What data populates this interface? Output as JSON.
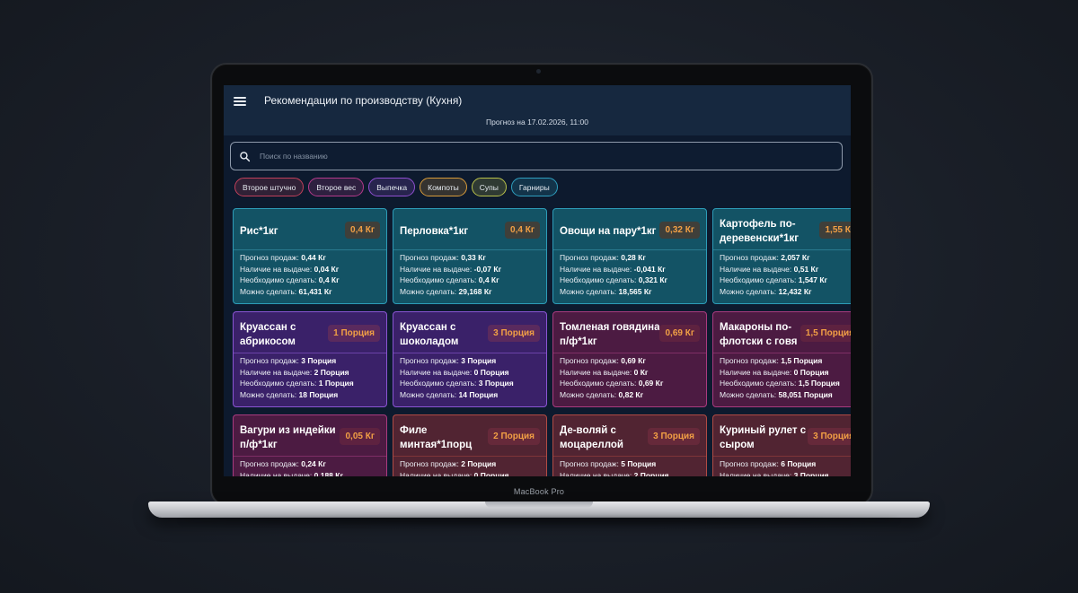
{
  "device": {
    "label": "MacBook Pro"
  },
  "app": {
    "title": "Рекомендации по производству (Кухня)",
    "forecast": "Прогноз на 17.02.2026, 11:00"
  },
  "search": {
    "placeholder": "Поиск по названию",
    "value": ""
  },
  "stat_labels": {
    "forecast": "Прогноз продаж:",
    "available": "Наличие на выдаче:",
    "needed": "Необходимо сделать:",
    "possible": "Можно сделать:"
  },
  "chips": [
    {
      "label": "Второе штучно",
      "color": "#c0405a"
    },
    {
      "label": "Второе вес",
      "color": "#b43a8a"
    },
    {
      "label": "Выпечка",
      "color": "#8f4fd0"
    },
    {
      "label": "Компоты",
      "color": "#d69a3a"
    },
    {
      "label": "Супы",
      "color": "#b8c04a"
    },
    {
      "label": "Гарниры",
      "color": "#2e9fbf"
    }
  ],
  "cards": [
    {
      "title": "Рис*1кг",
      "badge": "0,4 Кг",
      "forecast": "0,44 Кг",
      "available": "0,04 Кг",
      "needed": "0,4 Кг",
      "possible": "61,431 Кг",
      "theme": "teal"
    },
    {
      "title": "Перловка*1кг",
      "badge": "0,4 Кг",
      "forecast": "0,33 Кг",
      "available": "-0,07 Кг",
      "needed": "0,4 Кг",
      "possible": "29,168 Кг",
      "theme": "teal"
    },
    {
      "title": "Овощи на пару*1кг",
      "badge": "0,32 Кг",
      "forecast": "0,28 Кг",
      "available": "-0,041 Кг",
      "needed": "0,321 Кг",
      "possible": "18,565 Кг",
      "theme": "teal"
    },
    {
      "title": "Картофель по-деревенски*1кг",
      "badge": "1,55 Кг",
      "forecast": "2,057 Кг",
      "available": "0,51 Кг",
      "needed": "1,547 Кг",
      "possible": "12,432 Кг",
      "theme": "teal"
    },
    {
      "title": "Круассан с абрикосом",
      "badge": "1 Порция",
      "forecast": "3 Порция",
      "available": "2 Порция",
      "needed": "1 Порция",
      "possible": "18 Порция",
      "theme": "purple"
    },
    {
      "title": "Круассан с шоколадом",
      "badge": "3 Порция",
      "forecast": "3 Порция",
      "available": "0 Порция",
      "needed": "3 Порция",
      "possible": "14 Порция",
      "theme": "purple"
    },
    {
      "title": "Томленая говядина п/ф*1кг",
      "badge": "0,69 Кг",
      "forecast": "0,69 Кг",
      "available": "0 Кг",
      "needed": "0,69 Кг",
      "possible": "0,82 Кг",
      "theme": "wine"
    },
    {
      "title": "Макароны по-флотски с говя",
      "badge": "1,5 Порция",
      "forecast": "1,5 Порция",
      "available": "0 Порция",
      "needed": "1,5 Порция",
      "possible": "58,051 Порция",
      "theme": "wine"
    },
    {
      "title": "Вагури из индейки п/ф*1кг",
      "badge": "0,05 Кг",
      "forecast": "0,24 Кг",
      "available": "0,188 Кг",
      "needed": "",
      "possible": "",
      "theme": "wine"
    },
    {
      "title": "Филе минтая*1порц",
      "badge": "2 Порция",
      "forecast": "2 Порция",
      "available": "0 Порция",
      "needed": "",
      "possible": "",
      "theme": "rust"
    },
    {
      "title": "Де-воляй с моцареллой",
      "badge": "3 Порция",
      "forecast": "5 Порция",
      "available": "2 Порция",
      "needed": "",
      "possible": "",
      "theme": "rust"
    },
    {
      "title": "Куриный рулет с сыром",
      "badge": "3 Порция",
      "forecast": "6 Порция",
      "available": "3 Порция",
      "needed": "",
      "possible": "",
      "theme": "rust"
    }
  ]
}
